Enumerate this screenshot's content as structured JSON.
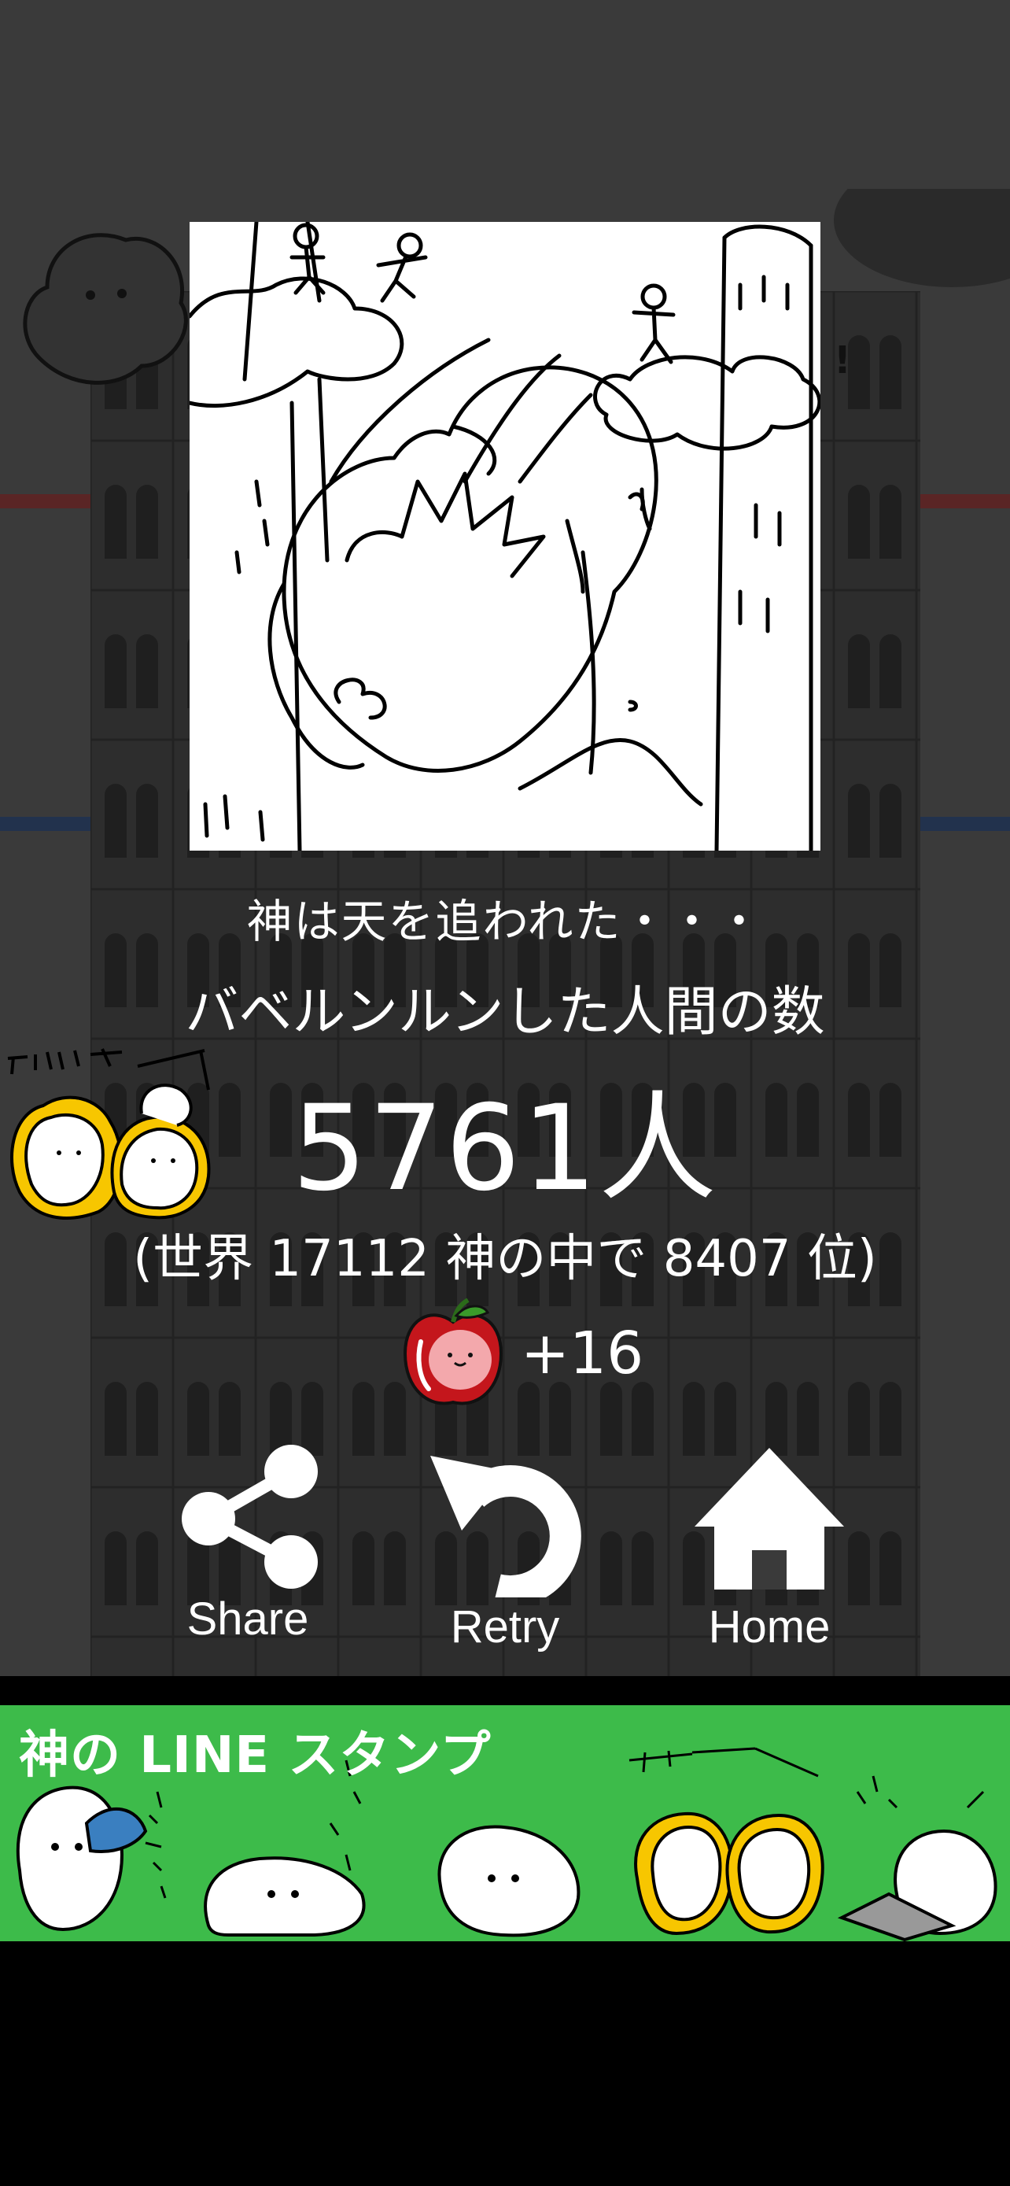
{
  "result": {
    "caption": "神は天を追われた・・・",
    "count_label": "バベルンルンした人間の数",
    "count_value": "5761人",
    "rank_text": "(世界 17112 神の中で 8407 位)",
    "apple_reward": "+16"
  },
  "buttons": {
    "share_label": "Share",
    "retry_label": "Retry",
    "home_label": "Home"
  },
  "banner": {
    "title": "神の LINE スタンプ"
  },
  "icons": {
    "share": "share-icon",
    "retry": "retry-icon",
    "home": "home-icon",
    "apple": "apple-icon"
  },
  "colors": {
    "banner_green": "#3dbb4a",
    "apple_red": "#c4161c",
    "background_dim": "#3a3a3a"
  }
}
